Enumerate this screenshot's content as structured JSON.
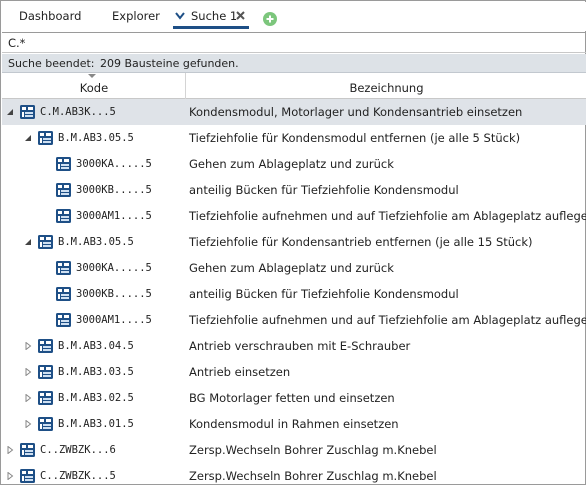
{
  "tabs": [
    {
      "label": "Dashboard"
    },
    {
      "label": "Explorer"
    },
    {
      "label": "Suche 1"
    }
  ],
  "search": {
    "value": "C.*"
  },
  "status": {
    "label": "Suche beendet:",
    "count_text": "209 Bausteine gefunden."
  },
  "columns": {
    "kode": "Kode",
    "bezeichnung": "Bezeichnung"
  },
  "rows": [
    {
      "code": "C.M.AB3K...5",
      "desc": "Kondensmodul, Motorlager und Kondensantrieb einsetzen",
      "expander": "expanded",
      "selected": true
    },
    {
      "code": "B.M.AB3.05.5",
      "desc": "Tiefziehfolie für Kondensmodul entfernen (je alle 5 Stück)",
      "expander": "expanded"
    },
    {
      "code": "3000KA.....5",
      "desc": "Gehen zum Ablageplatz und zurück",
      "expander": "none"
    },
    {
      "code": "3000KB.....5",
      "desc": "anteilig Bücken für Tiefziehfolie Kondensmodul",
      "expander": "none"
    },
    {
      "code": "3000AM1....5",
      "desc": "Tiefziehfolie aufnehmen und auf Tiefziehfolie am Ablageplatz auflegen",
      "expander": "none"
    },
    {
      "code": "B.M.AB3.05.5",
      "desc": "Tiefziehfolie für Kondensantrieb entfernen (je alle 15 Stück)",
      "expander": "expanded"
    },
    {
      "code": "3000KA.....5",
      "desc": "Gehen zum Ablageplatz und zurück",
      "expander": "none"
    },
    {
      "code": "3000KB.....5",
      "desc": "anteilig Bücken für Tiefziehfolie Kondensmodul",
      "expander": "none"
    },
    {
      "code": "3000AM1....5",
      "desc": "Tiefziehfolie aufnehmen und auf Tiefziehfolie am Ablageplatz auflegen",
      "expander": "none"
    },
    {
      "code": "B.M.AB3.04.5",
      "desc": "Antrieb verschrauben mit E-Schrauber",
      "expander": "collapsed"
    },
    {
      "code": "B.M.AB3.03.5",
      "desc": "Antrieb einsetzen",
      "expander": "collapsed"
    },
    {
      "code": "B.M.AB3.02.5",
      "desc": "BG Motorlager fetten und einsetzen",
      "expander": "collapsed"
    },
    {
      "code": "B.M.AB3.01.5",
      "desc": "Kondensmodul in Rahmen einsetzen",
      "expander": "collapsed"
    },
    {
      "code": "C..ZWBZK...6",
      "desc": "Zersp.Wechseln Bohrer Zuschlag m.Knebel",
      "expander": "collapsed"
    },
    {
      "code": "C..ZWBZK...5",
      "desc": "Zersp.Wechseln Bohrer Zuschlag m.Knebel",
      "expander": "collapsed"
    }
  ],
  "icons": {
    "tab_active_marker": "chevron-down-icon",
    "tab_close": "close-icon",
    "tab_add": "plus-circle-icon",
    "node": "module-block-icon",
    "node_color": "#1e4f86",
    "add_color": "#7cc67c"
  }
}
